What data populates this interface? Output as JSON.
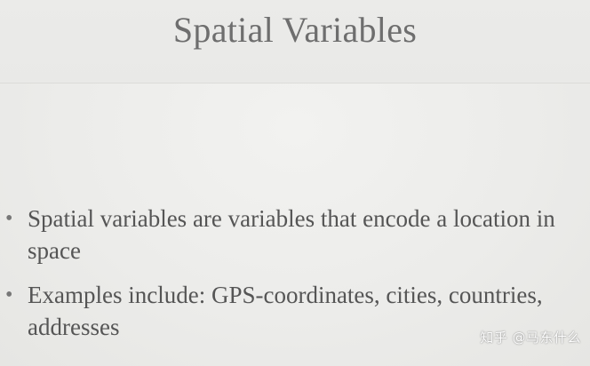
{
  "slide": {
    "title": "Spatial Variables",
    "bullets": [
      {
        "text": "Spatial variables are variables that encode a location in space"
      },
      {
        "text": "Examples include: GPS-coordinates, cities, countries, addresses"
      }
    ],
    "bullet_glyph": "•"
  },
  "watermark": {
    "text": "知乎 @马东什么"
  },
  "colors": {
    "background": "#eeeeec",
    "title_text": "#6e6e6e",
    "body_text": "#555555"
  }
}
